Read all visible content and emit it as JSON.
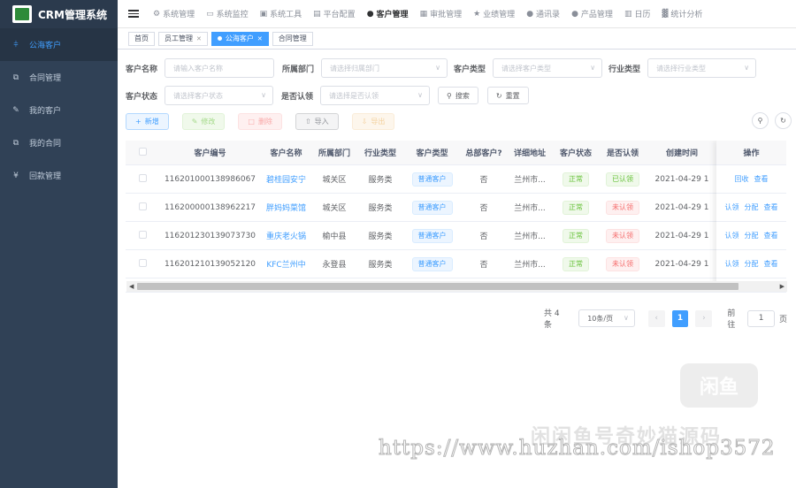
{
  "app": {
    "title": "CRM管理系统"
  },
  "sidebar": {
    "items": [
      {
        "label": "公海客户",
        "icon": "sitemap-icon"
      },
      {
        "label": "合同管理",
        "icon": "copy-icon"
      },
      {
        "label": "我的客户",
        "icon": "edit-icon"
      },
      {
        "label": "我的合同",
        "icon": "copy-icon"
      },
      {
        "label": "回款管理",
        "icon": "yen-icon"
      }
    ]
  },
  "topnav": [
    {
      "label": "系统管理",
      "icon": "gear-icon"
    },
    {
      "label": "系统监控",
      "icon": "monitor-icon"
    },
    {
      "label": "系统工具",
      "icon": "toolbox-icon"
    },
    {
      "label": "平台配置",
      "icon": "server-icon"
    },
    {
      "label": "客户管理",
      "icon": "user-icon"
    },
    {
      "label": "审批管理",
      "icon": "grid-icon"
    },
    {
      "label": "业绩管理",
      "icon": "star-icon"
    },
    {
      "label": "通讯录",
      "icon": "contact-icon"
    },
    {
      "label": "产品管理",
      "icon": "product-icon"
    },
    {
      "label": "日历",
      "icon": "calendar-icon"
    },
    {
      "label": "统计分析",
      "icon": "chart-icon"
    }
  ],
  "tags": [
    {
      "label": "首页"
    },
    {
      "label": "员工管理"
    },
    {
      "label": "公海客户"
    },
    {
      "label": "合同管理"
    }
  ],
  "filters": {
    "customer_name": {
      "label": "客户名称",
      "placeholder": "请输入客户名称"
    },
    "department": {
      "label": "所属部门",
      "placeholder": "请选择归属部门"
    },
    "customer_type": {
      "label": "客户类型",
      "placeholder": "请选择客户类型"
    },
    "industry_type": {
      "label": "行业类型",
      "placeholder": "请选择行业类型"
    },
    "customer_status": {
      "label": "客户状态",
      "placeholder": "请选择客户状态"
    },
    "claimed": {
      "label": "是否认领",
      "placeholder": "请选择是否认领"
    },
    "search_label": "搜索",
    "reset_label": "重置"
  },
  "toolbar": {
    "add_label": "新增",
    "edit_label": "修改",
    "delete_label": "删除",
    "import_label": "导入",
    "export_label": "导出"
  },
  "table": {
    "columns": [
      "客户编号",
      "客户名称",
      "所属部门",
      "行业类型",
      "客户类型",
      "总部客户?",
      "详细地址",
      "客户状态",
      "是否认领",
      "创建时间",
      "操作"
    ],
    "rows": [
      {
        "id": "116201000138986067",
        "name": "碧桂园安宁",
        "dept": "城关区",
        "industry": "服务类",
        "type": "普通客户",
        "hq": "否",
        "address": "兰州市...",
        "status": "正常",
        "claimed": "已认领",
        "claimed_ok": true,
        "created": "2021-04-29 1",
        "ops": [
          "回收",
          "查看"
        ]
      },
      {
        "id": "116200000138962217",
        "name": "胖妈妈菜馆",
        "dept": "城关区",
        "industry": "服务类",
        "type": "普通客户",
        "hq": "否",
        "address": "兰州市...",
        "status": "正常",
        "claimed": "未认领",
        "claimed_ok": false,
        "created": "2021-04-29 1",
        "ops": [
          "认领",
          "分配",
          "查看"
        ]
      },
      {
        "id": "116201230139073730",
        "name": "重庆老火锅",
        "dept": "榆中县",
        "industry": "服务类",
        "type": "普通客户",
        "hq": "否",
        "address": "兰州市...",
        "status": "正常",
        "claimed": "未认领",
        "claimed_ok": false,
        "created": "2021-04-29 1",
        "ops": [
          "认领",
          "分配",
          "查看"
        ]
      },
      {
        "id": "116201210139052120",
        "name": "KFC兰州中",
        "dept": "永登县",
        "industry": "服务类",
        "type": "普通客户",
        "hq": "否",
        "address": "兰州市...",
        "status": "正常",
        "claimed": "未认领",
        "claimed_ok": false,
        "created": "2021-04-29 1",
        "ops": [
          "认领",
          "分配",
          "查看"
        ]
      }
    ]
  },
  "pagination": {
    "total_text": "共 4 条",
    "page_size": "10条/页",
    "current_page": "1",
    "goto_label": "前往",
    "goto_value": "1",
    "page_suffix": "页"
  },
  "watermark": {
    "logo_text": "闲鱼",
    "cn_text": "闲闲鱼号奇妙猫源码",
    "url_text": "https://www.huzhan.com/ishop3572"
  }
}
